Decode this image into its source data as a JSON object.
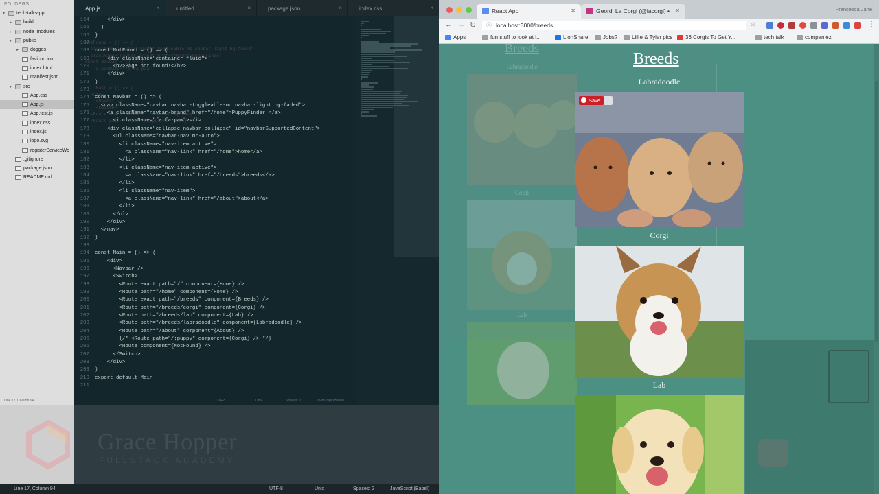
{
  "editor": {
    "sidebar": {
      "header": "FOLDERS",
      "items": [
        {
          "label": "tech-talk-app",
          "type": "folder",
          "open": true,
          "depth": 0
        },
        {
          "label": "build",
          "type": "folder",
          "open": false,
          "depth": 1
        },
        {
          "label": "node_modules",
          "type": "folder",
          "open": false,
          "depth": 1
        },
        {
          "label": "public",
          "type": "folder",
          "open": true,
          "depth": 1
        },
        {
          "label": "doggos",
          "type": "folder",
          "open": false,
          "depth": 2
        },
        {
          "label": "favicon.ico",
          "type": "file",
          "depth": 2
        },
        {
          "label": "index.html",
          "type": "file",
          "depth": 2
        },
        {
          "label": "manifest.json",
          "type": "file",
          "depth": 2
        },
        {
          "label": "src",
          "type": "folder",
          "open": true,
          "depth": 1
        },
        {
          "label": "App.css",
          "type": "file",
          "depth": 2
        },
        {
          "label": "App.js",
          "type": "file",
          "depth": 2,
          "selected": true
        },
        {
          "label": "App.test.js",
          "type": "file",
          "depth": 2
        },
        {
          "label": "index.css",
          "type": "file",
          "depth": 2
        },
        {
          "label": "index.js",
          "type": "file",
          "depth": 2
        },
        {
          "label": "logo.svg",
          "type": "file",
          "depth": 2
        },
        {
          "label": "registerServiceWo",
          "type": "file",
          "depth": 2
        },
        {
          "label": ".gitignore",
          "type": "file",
          "depth": 1
        },
        {
          "label": "package.json",
          "type": "file",
          "depth": 1
        },
        {
          "label": "README.md",
          "type": "file",
          "depth": 1
        }
      ]
    },
    "tabs": [
      {
        "label": "App.js",
        "active": true
      },
      {
        "label": "untitled",
        "active": false
      },
      {
        "label": "package.json",
        "active": false
      },
      {
        "label": "index.css",
        "active": false
      }
    ],
    "code_lines": [
      {
        "n": "164",
        "text": "    </div>"
      },
      {
        "n": "165",
        "text": "  )"
      },
      {
        "n": "166",
        "text": "}"
      },
      {
        "n": "167",
        "text": ""
      },
      {
        "n": "168",
        "text": "const NotFound = () => ("
      },
      {
        "n": "169",
        "text": "    <div className=\"container-fluid\">"
      },
      {
        "n": "170",
        "text": "      <h2>Page not found!</h2>"
      },
      {
        "n": "171",
        "text": "    </div>"
      },
      {
        "n": "172",
        "text": ")"
      },
      {
        "n": "173",
        "text": ""
      },
      {
        "n": "174",
        "text": "const Navbar = () => ("
      },
      {
        "n": "175",
        "text": "  <nav className=\"navbar navbar-toggleable-md navbar-light bg-faded\">"
      },
      {
        "n": "176",
        "text": "    <a className=\"navbar-brand\" href=\"/home\">PuppyFinder </a>"
      },
      {
        "n": "177",
        "text": "      <i className=\"fa fa-paw\"></i>"
      },
      {
        "n": "178",
        "text": "    <div className=\"collapse navbar-collapse\" id=\"navbarSupportedContent\">"
      },
      {
        "n": "179",
        "text": "      <ul className=\"navbar-nav mr-auto\">"
      },
      {
        "n": "180",
        "text": "        <li className=\"nav-item active\">"
      },
      {
        "n": "181",
        "text": "          <a className=\"nav-link\" href=\"/home\">home</a>"
      },
      {
        "n": "182",
        "text": "        </li>"
      },
      {
        "n": "183",
        "text": "        <li className=\"nav-item active\">"
      },
      {
        "n": "184",
        "text": "          <a className=\"nav-link\" href=\"/breeds\">breeds</a>"
      },
      {
        "n": "185",
        "text": "        </li>"
      },
      {
        "n": "186",
        "text": "        <li className=\"nav-item\">"
      },
      {
        "n": "187",
        "text": "          <a className=\"nav-link\" href=\"/about\">about</a>"
      },
      {
        "n": "188",
        "text": "        </li>"
      },
      {
        "n": "189",
        "text": "      </ul>"
      },
      {
        "n": "190",
        "text": "    </div>"
      },
      {
        "n": "191",
        "text": "  </nav>"
      },
      {
        "n": "192",
        "text": ")"
      },
      {
        "n": "193",
        "text": ""
      },
      {
        "n": "194",
        "text": "const Main = () => ("
      },
      {
        "n": "195",
        "text": "    <div>"
      },
      {
        "n": "196",
        "text": "      <Navbar />"
      },
      {
        "n": "197",
        "text": "      <Switch>"
      },
      {
        "n": "198",
        "text": "        <Route exact path=\"/\" component={Home} />"
      },
      {
        "n": "199",
        "text": "        <Route path=\"/home\" component={Home} />"
      },
      {
        "n": "200",
        "text": "        <Route exact path=\"/breeds\" component={Breeds} />"
      },
      {
        "n": "201",
        "text": "        <Route path=\"/breeds/corgi\" component={Corgi} />"
      },
      {
        "n": "202",
        "text": "        <Route path=\"/breeds/lab\" component={Lab} />"
      },
      {
        "n": "203",
        "text": "        <Route path=\"/breeds/labradoodle\" component={Labradoodle} />"
      },
      {
        "n": "204",
        "text": "        <Route path=\"/about\" component={About} />"
      },
      {
        "n": "205",
        "text": "        {/* <Route path=\"/:puppy\" component={Corgi} /> */}"
      },
      {
        "n": "206",
        "text": "        <Route component={NotFound} />"
      },
      {
        "n": "207",
        "text": "      </Switch>"
      },
      {
        "n": "208",
        "text": "    </div>"
      },
      {
        "n": "209",
        "text": ")"
      },
      {
        "n": "210",
        "text": "export default Main"
      },
      {
        "n": "211",
        "text": ""
      }
    ],
    "status": {
      "position": "Line 17, Column 94",
      "encoding": "UTF-8",
      "line_endings": "Unix",
      "indent": "Spaces: 2",
      "syntax": "JavaScript (Babel)"
    },
    "watermark": {
      "title": "Grace Hopper",
      "subtitle": "FULLSTACK ACADEMY"
    }
  },
  "browser": {
    "tabs": [
      {
        "label": "React App",
        "active": true,
        "favicon_color": "#5b8def"
      },
      {
        "label": "Geordi La Corgi (@lacorgi) •",
        "active": false,
        "favicon_color": "#c13584"
      }
    ],
    "user_name": "Francesca Jane",
    "url": "localhost:3000/breeds",
    "bookmarks": [
      {
        "label": "Apps",
        "icon_color": "#4285f4"
      },
      {
        "label": "fun stuff to look at l...",
        "icon_color": "#9aa0a6"
      },
      {
        "label": "LionShare",
        "icon_color": "#1a73e8"
      },
      {
        "label": "Jobs?",
        "icon_color": "#9aa0a6"
      },
      {
        "label": "Lillie & Tyler pics",
        "icon_color": "#9aa0a6"
      },
      {
        "label": "36 Corgis To Get Y...",
        "icon_color": "#e53935"
      },
      {
        "label": "tech talk",
        "icon_color": "#9aa0a6"
      },
      {
        "label": "companiez",
        "icon_color": "#9aa0a6"
      }
    ],
    "page": {
      "heading": "Breeds",
      "breeds": [
        {
          "name": "Labradoodle",
          "photo": "labradoodle-puppies"
        },
        {
          "name": "Corgi",
          "photo": "corgi-puppy"
        },
        {
          "name": "Lab",
          "photo": "lab-puppy"
        }
      ],
      "save_label": "Save"
    }
  }
}
